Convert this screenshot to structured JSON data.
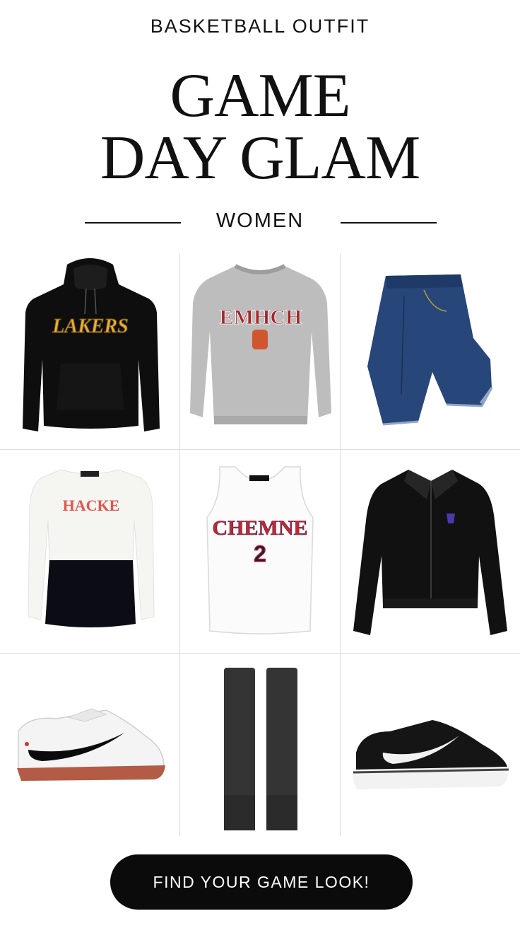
{
  "header": {
    "kicker": "BASKETBALL OUTFIT",
    "title_line1": "GAME",
    "title_line2": "DAY GLAM",
    "subtitle": "WOMEN"
  },
  "items": {
    "hoodie": {
      "graphic": "LAKERS",
      "color": "#0e0e0e",
      "accent": "#e3b23c"
    },
    "sweatshirt": {
      "graphic": "EMHCH",
      "color": "#b9b9b9",
      "accent": "#a3262b"
    },
    "jeans": {
      "color": "#27467a"
    },
    "top": {
      "graphic": "HACKE",
      "color": "#f7f7f5",
      "accent": "#e0574e"
    },
    "tank": {
      "graphic": "CHEMNE",
      "number": "2",
      "color": "#fbfbfb",
      "accent": "#c8262f"
    },
    "jacket": {
      "color": "#111111"
    },
    "sneaker_white": {
      "color": "#f4f4f4",
      "accent": "#0b0b0b"
    },
    "socks": {
      "color": "#343434"
    },
    "sneaker_black": {
      "color": "#151515",
      "accent": "#f2f2f2"
    }
  },
  "cta": {
    "label": "FIND YOUR GAME LOOK!"
  }
}
